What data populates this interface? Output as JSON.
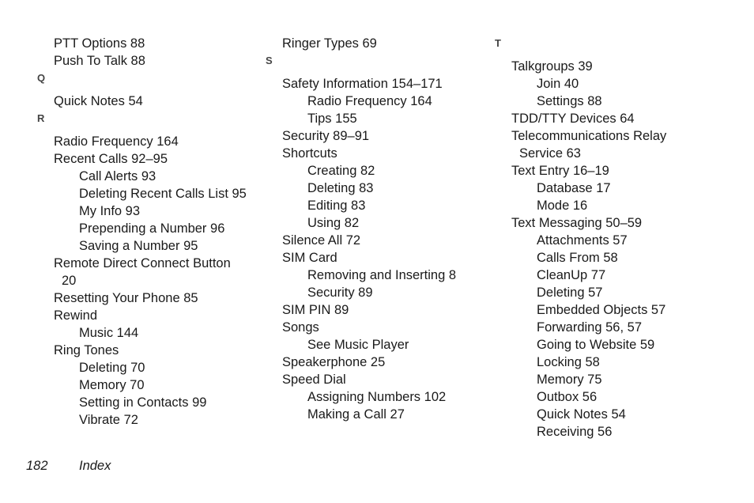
{
  "document": {
    "page_number": "182",
    "section_label": "Index",
    "text_color": "#1a1a1a",
    "heading_color": "#444444",
    "background_color": "#ffffff"
  },
  "columns": [
    {
      "id": "column-1",
      "lines": [
        {
          "type": "entry",
          "level": 1,
          "text": "PTT Options 88"
        },
        {
          "type": "entry",
          "level": 1,
          "text": "Push To Talk 88"
        },
        {
          "type": "letter",
          "text": "Q"
        },
        {
          "type": "spacer"
        },
        {
          "type": "entry",
          "level": 1,
          "text": "Quick Notes 54"
        },
        {
          "type": "letter",
          "text": "R"
        },
        {
          "type": "spacer"
        },
        {
          "type": "entry",
          "level": 1,
          "text": "Radio Frequency 164"
        },
        {
          "type": "entry",
          "level": 1,
          "text": "Recent Calls 92–95"
        },
        {
          "type": "entry",
          "level": 2,
          "text": "Call Alerts 93"
        },
        {
          "type": "entry",
          "level": 2,
          "text": "Deleting Recent Calls List 95"
        },
        {
          "type": "entry",
          "level": 2,
          "text": "My Info 93"
        },
        {
          "type": "entry",
          "level": 2,
          "text": "Prepending a Number 96"
        },
        {
          "type": "entry",
          "level": 2,
          "text": "Saving a Number 95"
        },
        {
          "type": "entry",
          "level": 1,
          "text": "Remote Direct Connect Button"
        },
        {
          "type": "entry",
          "level": 0,
          "continuation": true,
          "text": "20"
        },
        {
          "type": "entry",
          "level": 1,
          "text": "Resetting Your Phone 85"
        },
        {
          "type": "entry",
          "level": 1,
          "text": "Rewind"
        },
        {
          "type": "entry",
          "level": 2,
          "text": "Music 144"
        },
        {
          "type": "entry",
          "level": 1,
          "text": "Ring Tones"
        },
        {
          "type": "entry",
          "level": 2,
          "text": "Deleting 70"
        },
        {
          "type": "entry",
          "level": 2,
          "text": "Memory 70"
        },
        {
          "type": "entry",
          "level": 2,
          "text": "Setting in Contacts 99"
        },
        {
          "type": "entry",
          "level": 2,
          "text": "Vibrate 72"
        }
      ]
    },
    {
      "id": "column-2",
      "lines": [
        {
          "type": "entry",
          "level": 1,
          "text": "Ringer Types 69"
        },
        {
          "type": "letter",
          "text": "S"
        },
        {
          "type": "spacer"
        },
        {
          "type": "entry",
          "level": 1,
          "text": "Safety Information 154–171"
        },
        {
          "type": "entry",
          "level": 2,
          "text": "Radio Frequency 164"
        },
        {
          "type": "entry",
          "level": 2,
          "text": "Tips 155"
        },
        {
          "type": "entry",
          "level": 1,
          "text": "Security 89–91"
        },
        {
          "type": "entry",
          "level": 1,
          "text": "Shortcuts"
        },
        {
          "type": "entry",
          "level": 2,
          "text": "Creating 82"
        },
        {
          "type": "entry",
          "level": 2,
          "text": "Deleting 83"
        },
        {
          "type": "entry",
          "level": 2,
          "text": "Editing 83"
        },
        {
          "type": "entry",
          "level": 2,
          "text": "Using 82"
        },
        {
          "type": "entry",
          "level": 1,
          "text": "Silence All 72"
        },
        {
          "type": "entry",
          "level": 1,
          "text": "SIM Card"
        },
        {
          "type": "entry",
          "level": 2,
          "text": "Removing and Inserting 8"
        },
        {
          "type": "entry",
          "level": 2,
          "text": "Security 89"
        },
        {
          "type": "entry",
          "level": 1,
          "text": "SIM PIN 89"
        },
        {
          "type": "entry",
          "level": 1,
          "text": "Songs"
        },
        {
          "type": "entry",
          "level": 2,
          "text": "See Music Player"
        },
        {
          "type": "entry",
          "level": 1,
          "text": "Speakerphone 25"
        },
        {
          "type": "entry",
          "level": 1,
          "text": "Speed Dial"
        },
        {
          "type": "entry",
          "level": 2,
          "text": "Assigning Numbers 102"
        },
        {
          "type": "entry",
          "level": 2,
          "text": "Making a Call 27"
        }
      ]
    },
    {
      "id": "column-3",
      "lines": [
        {
          "type": "letter",
          "text": "T"
        },
        {
          "type": "spacer"
        },
        {
          "type": "entry",
          "level": 1,
          "text": "Talkgroups 39"
        },
        {
          "type": "entry",
          "level": 2,
          "text": "Join 40"
        },
        {
          "type": "entry",
          "level": 2,
          "text": "Settings 88"
        },
        {
          "type": "entry",
          "level": 1,
          "text": "TDD/TTY Devices 64"
        },
        {
          "type": "entry",
          "level": 1,
          "text": "Telecommunications Relay"
        },
        {
          "type": "entry",
          "level": 0,
          "continuation": true,
          "text": "Service 63"
        },
        {
          "type": "entry",
          "level": 1,
          "text": "Text Entry 16–19"
        },
        {
          "type": "entry",
          "level": 2,
          "text": "Database 17"
        },
        {
          "type": "entry",
          "level": 2,
          "text": "Mode 16"
        },
        {
          "type": "entry",
          "level": 1,
          "text": "Text Messaging 50–59"
        },
        {
          "type": "entry",
          "level": 2,
          "text": "Attachments 57"
        },
        {
          "type": "entry",
          "level": 2,
          "text": "Calls From 58"
        },
        {
          "type": "entry",
          "level": 2,
          "text": "CleanUp 77"
        },
        {
          "type": "entry",
          "level": 2,
          "text": "Deleting 57"
        },
        {
          "type": "entry",
          "level": 2,
          "text": "Embedded Objects 57"
        },
        {
          "type": "entry",
          "level": 2,
          "text": "Forwarding 56, 57"
        },
        {
          "type": "entry",
          "level": 2,
          "text": "Going to Website 59"
        },
        {
          "type": "entry",
          "level": 2,
          "text": "Locking 58"
        },
        {
          "type": "entry",
          "level": 2,
          "text": "Memory 75"
        },
        {
          "type": "entry",
          "level": 2,
          "text": "Outbox 56"
        },
        {
          "type": "entry",
          "level": 2,
          "text": "Quick Notes 54"
        },
        {
          "type": "entry",
          "level": 2,
          "text": "Receiving 56"
        }
      ]
    }
  ]
}
